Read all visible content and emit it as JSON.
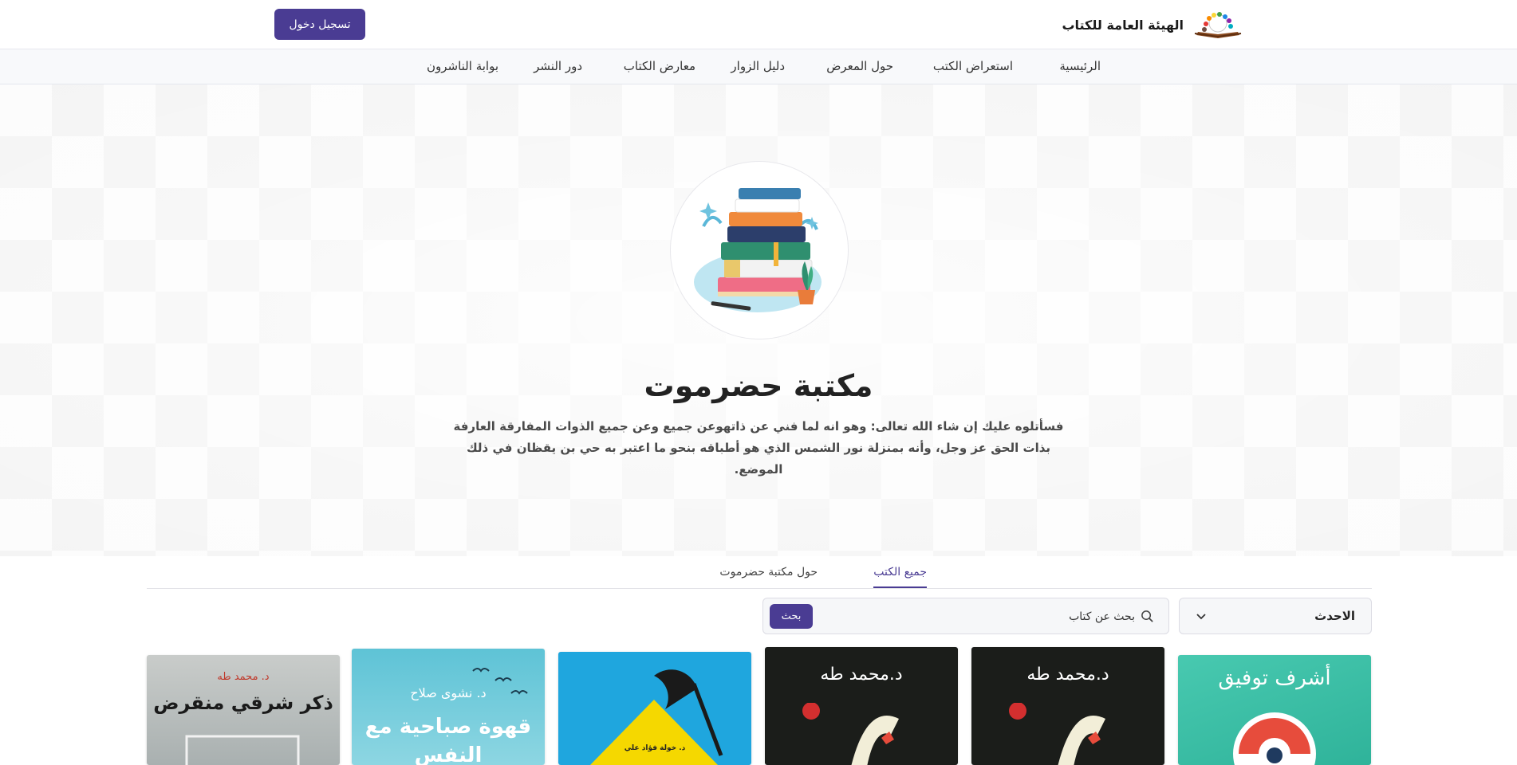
{
  "header": {
    "brand_name": "الهيئة العامة للكتاب",
    "login_label": "تسجيل دخول"
  },
  "nav": {
    "items": [
      {
        "label": "الرئيسية"
      },
      {
        "label": "استعراض الكتب"
      },
      {
        "label": "حول المعرض"
      },
      {
        "label": "دليل الزوار"
      },
      {
        "label": "معارض الكتاب"
      },
      {
        "label": "دور النشر"
      },
      {
        "label": "بوابة الناشرون"
      }
    ]
  },
  "hero": {
    "title": "مكتبة حضرموت",
    "description_line1": "فسأتلوه عليك إن شاء الله تعالى: وهو انه لما فني عن ذاتهوعن جميع وعن جميع الذوات المفارقة العارفة",
    "description_line2": "بذات الحق عز وجل، وأنه بمنزلة نور الشمس الذي هو أطباقه بنحو ما اعتبر به حي بن يقظان في ذلك الموضع."
  },
  "tabs": {
    "all_books": "جميع الكتب",
    "about": "حول مكتبة حضرموت"
  },
  "filters": {
    "sort_selected": "الاحدث",
    "search_placeholder": "بحث عن كتاب",
    "search_button": "بحث"
  },
  "books": [
    {
      "author": "أشرف توفيق",
      "title": ""
    },
    {
      "author": "د.محمد طه",
      "title": ""
    },
    {
      "author": "د.محمد طه",
      "title": ""
    },
    {
      "author": "د. خولة فؤاد علي",
      "title": ""
    },
    {
      "author": "د. نشوى صلاح",
      "title": "قهوة صباحية مع النفس"
    },
    {
      "author": "د. محمد طه",
      "title": "ذكر شرقي منقرض"
    }
  ],
  "colors": {
    "accent": "#4a3c93"
  }
}
